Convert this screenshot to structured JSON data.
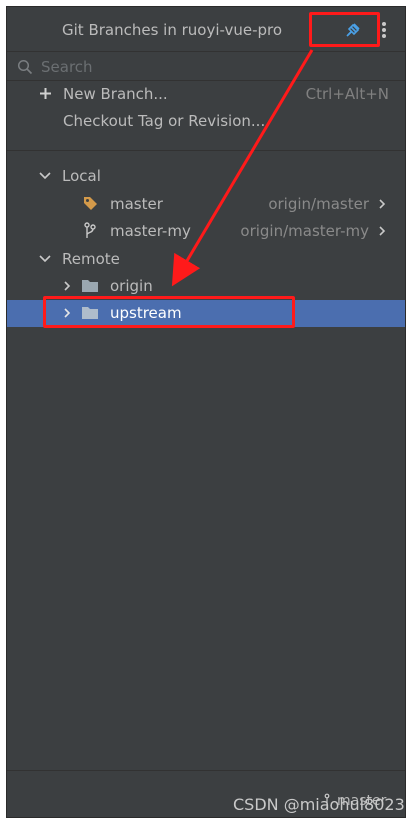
{
  "popup": {
    "title": "Git Branches in ruoyi-vue-pro"
  },
  "search": {
    "placeholder": "Search",
    "value": ""
  },
  "actions": [
    {
      "label": "New Branch...",
      "shortcut": "Ctrl+Alt+N",
      "icon": "plus-icon"
    },
    {
      "label": "Checkout Tag or Revision..."
    }
  ],
  "local": {
    "label": "Local",
    "branches": [
      {
        "name": "master",
        "tracking": "origin/master",
        "icon": "tag-icon"
      },
      {
        "name": "master-my",
        "tracking": "origin/master-my",
        "icon": "branch-icon"
      }
    ]
  },
  "remote": {
    "label": "Remote",
    "folders": [
      {
        "name": "origin",
        "icon": "folder-icon"
      },
      {
        "name": "upstream",
        "icon": "folder-icon",
        "selected": true
      }
    ]
  },
  "statusbar": {
    "branch": "master"
  },
  "watermark": "CSDN @miaohui8023",
  "colors": {
    "background": "#3c3f41",
    "selection": "#4b6eaf",
    "highlight": "#ff1a1a",
    "tag": "#d49a4a",
    "text": "#bbbbbb"
  }
}
